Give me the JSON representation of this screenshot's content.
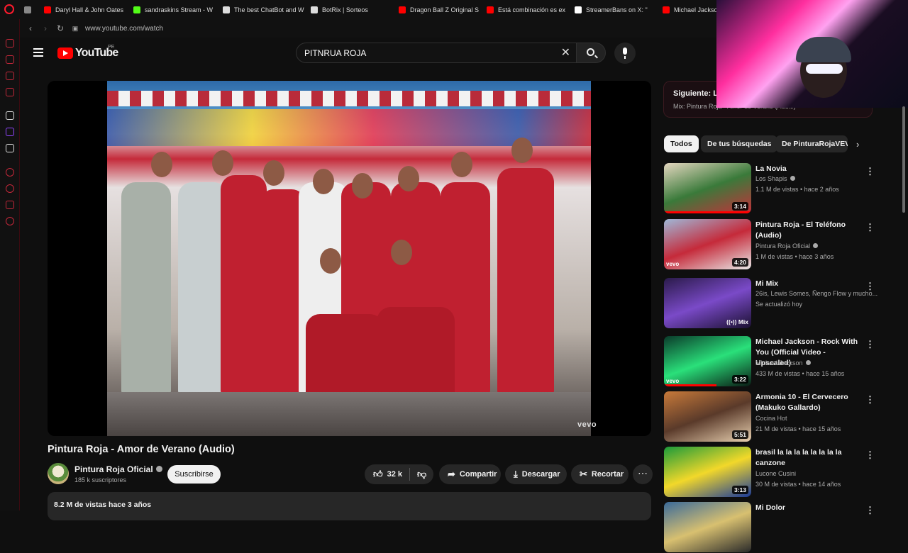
{
  "browser": {
    "tabs": [
      {
        "label": "",
        "color": "#888888"
      },
      {
        "label": "Daryl Hall & John Oates",
        "color": "#ff0000"
      },
      {
        "label": "sandraskins Stream - W",
        "color": "#53fc18"
      },
      {
        "label": "The best ChatBot and W",
        "color": "#dddddd"
      },
      {
        "label": "BotRix | Sorteos",
        "color": "#dddddd"
      },
      {
        "label": "Dragon Ball Z Original S",
        "color": "#ff0000"
      },
      {
        "label": "Está combinación es ex",
        "color": "#ff0000"
      },
      {
        "label": "StreamerBans on X: \"",
        "color": "#ffffff"
      },
      {
        "label": "Michael Jackson - E",
        "color": "#ff0000"
      }
    ],
    "url": "www.youtube.com/watch",
    "accent": "#ff1b2d"
  },
  "header": {
    "logo_text": "YouTube",
    "country_code": "PE",
    "search_value": "PITNRUA ROJA"
  },
  "video": {
    "title": "Pintura Roja - Amor de Verano (Audio)",
    "watermark": "vevo",
    "channel": "Pintura Roja Oficial",
    "subscribers": "185 k suscriptores",
    "subscribe_label": "Suscribirse",
    "likes": "32 k",
    "share_label": "Compartir",
    "download_label": "Descargar",
    "clip_label": "Recortar",
    "views_date": "8.2 M de vistas  hace 3 años"
  },
  "next": {
    "title": "Siguiente: La",
    "subtitle": "Mix: Pintura Roja - Amor de Verano (Audio)"
  },
  "chips": [
    "Todos",
    "De tus búsquedas",
    "De PinturaRojaVEVO"
  ],
  "recommendations": [
    {
      "title": "La Novia",
      "channel": "Los Shapis",
      "verified": true,
      "meta": "1.1 M de vistas • hace 2 años",
      "duration": "3:14",
      "vevo": false,
      "mix": false,
      "progress": 1.0,
      "thumb": [
        "#e5d7c0",
        "#3a7a3a",
        "#c5303a"
      ]
    },
    {
      "title": "Pintura Roja - El Teléfono (Audio)",
      "channel": "Pintura Roja Oficial",
      "verified": true,
      "meta": "1 M de vistas • hace 3 años",
      "duration": "4:20",
      "vevo": true,
      "mix": false,
      "progress": 0,
      "thumb": [
        "#9fb8d8",
        "#c52a3a",
        "#e8e8e8"
      ]
    },
    {
      "title": "Mi Mix",
      "channel": "26is, Lewis Somes, Ñengo Flow y mucho...",
      "verified": false,
      "meta": "Se actualizó hoy",
      "duration": "",
      "vevo": false,
      "mix": true,
      "progress": 0,
      "thumb": [
        "#2a1a4a",
        "#7a4ac8",
        "#1a1030"
      ]
    },
    {
      "title": "Michael Jackson - Rock With You (Official Video - Upscaled)",
      "channel": "Michael Jackson",
      "verified": true,
      "meta": "433 M de vistas • hace 15 años",
      "duration": "3:22",
      "vevo": true,
      "mix": false,
      "progress": 0.6,
      "thumb": [
        "#0a3a2a",
        "#2ae07a",
        "#0a1a14"
      ]
    },
    {
      "title": "Armonia 10 - El Cervecero (Makuko Gallardo)",
      "channel": "Cocina Hot",
      "verified": false,
      "meta": "21 M de vistas • hace 15 años",
      "duration": "5:51",
      "vevo": false,
      "mix": false,
      "progress": 0,
      "thumb": [
        "#c87a3a",
        "#5a3a2a",
        "#e8d0b0"
      ]
    },
    {
      "title": "brasil la la la la la la la la canzone",
      "channel": "Lucone Cusini",
      "verified": false,
      "meta": "30 M de vistas • hace 14 años",
      "duration": "3:13",
      "vevo": false,
      "mix": false,
      "progress": 0,
      "thumb": [
        "#1a9a3a",
        "#f2d82a",
        "#1a3a9a"
      ]
    },
    {
      "title": "Mi Dolor",
      "channel": "",
      "verified": false,
      "meta": "",
      "duration": "",
      "vevo": false,
      "mix": false,
      "progress": 0,
      "thumb": [
        "#3a6a9a",
        "#d8c070",
        "#2a2a2a"
      ]
    }
  ]
}
